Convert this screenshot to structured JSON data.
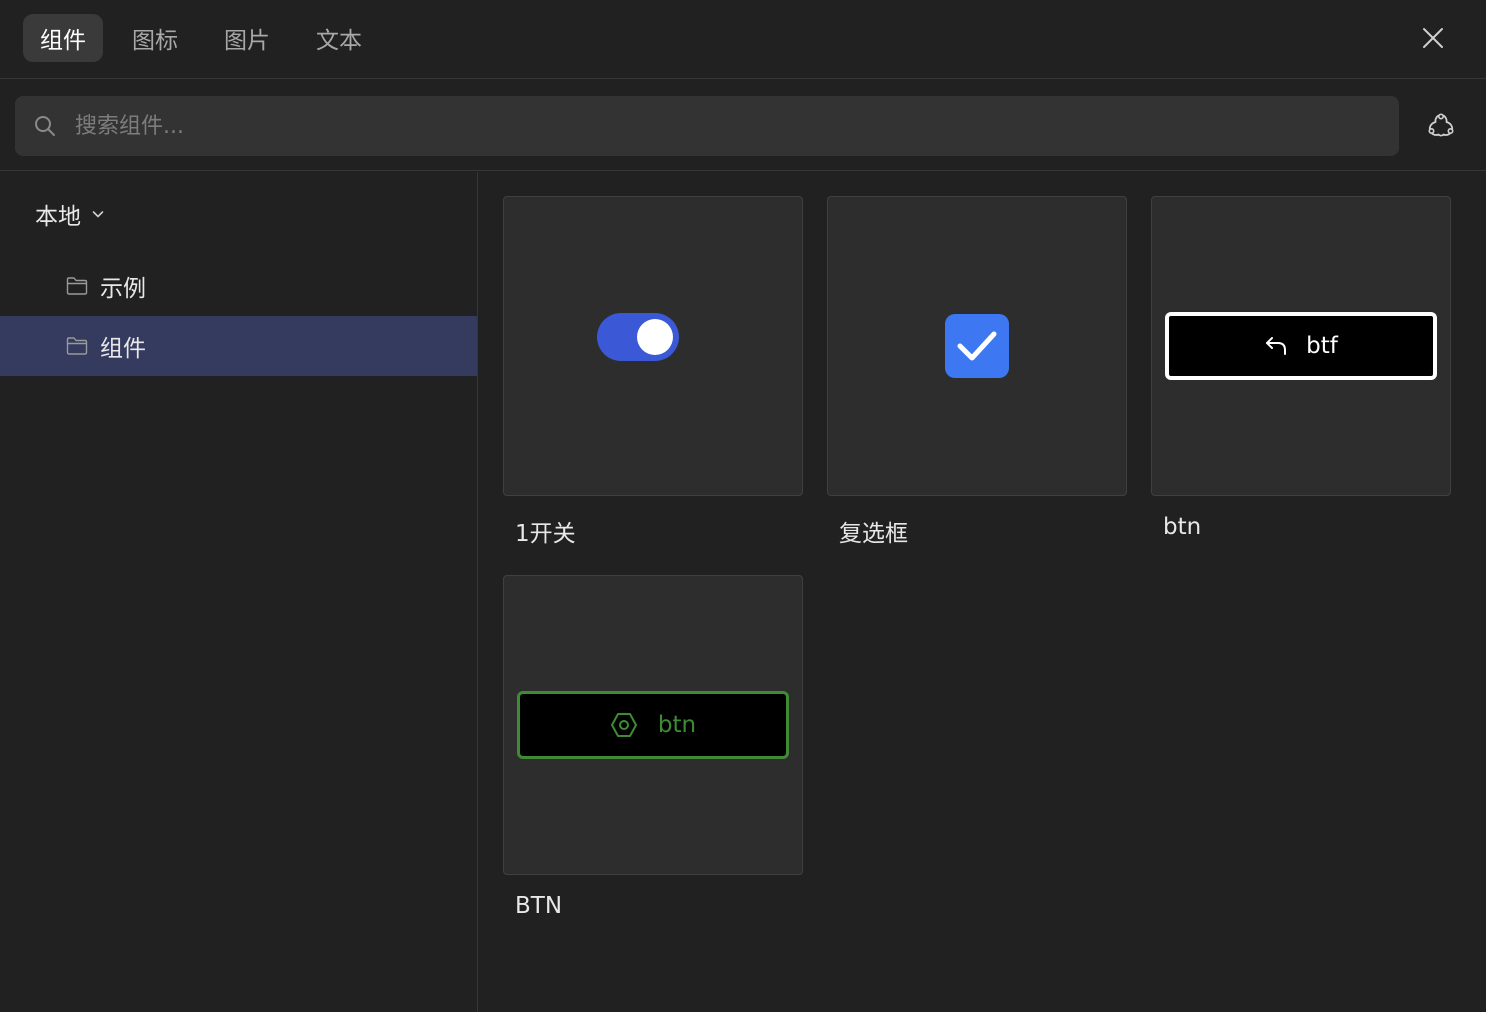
{
  "tabs": [
    {
      "label": "组件",
      "active": true
    },
    {
      "label": "图标",
      "active": false
    },
    {
      "label": "图片",
      "active": false
    },
    {
      "label": "文本",
      "active": false
    }
  ],
  "search": {
    "placeholder": "搜索组件...",
    "value": ""
  },
  "sidebar": {
    "section_label": "本地",
    "folders": [
      {
        "label": "示例",
        "active": false
      },
      {
        "label": "组件",
        "active": true
      }
    ]
  },
  "components": [
    {
      "label": "1开关",
      "preview": "toggle-switch"
    },
    {
      "label": "复选框",
      "preview": "checkbox"
    },
    {
      "label": "btn",
      "preview": "button",
      "button_text": "btf",
      "icon": "undo-arrow-icon"
    },
    {
      "label": "BTN",
      "preview": "button",
      "button_text": "btn",
      "icon": "hexagon-icon"
    }
  ],
  "colors": {
    "background": "#212121",
    "card": "#2d2d2d",
    "active_folder": "#343b5e",
    "toggle": "#3b59d6",
    "checkbox": "#3d78f2",
    "green_button": "#3e8b34"
  },
  "icons": {
    "close": "close-icon",
    "search": "search-icon",
    "plugin": "plugin-icon",
    "folder": "folder-icon",
    "chevron": "chevron-down-icon"
  }
}
